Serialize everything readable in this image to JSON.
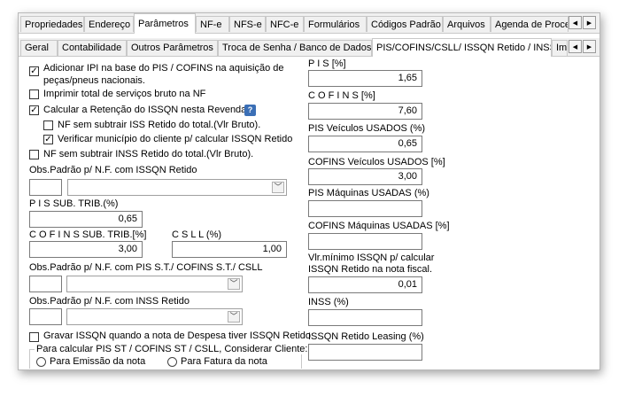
{
  "tabs": [
    "Propriedades",
    "Endereço",
    "Parâmetros",
    "NF-e",
    "NFS-e",
    "NFC-e",
    "Formulários",
    "Códigos Padrão",
    "Arquivos",
    "Agenda de Proces"
  ],
  "subtabs": [
    "Geral",
    "Contabilidade",
    "Outros Parâmetros",
    "Troca de Senha / Banco de Dados",
    "PIS/COFINS/CSLL/ ISSQN Retido / INSS",
    "Im"
  ],
  "left": {
    "cb_ipi": "Adicionar IPI na base do PIS / COFINS na aquisição de",
    "cb_ipi_2": "peças/pneus nacionais.",
    "cb_imprimir": "Imprimir total de serviços bruto na NF",
    "cb_calcular": "Calcular a Retenção do ISSQN nesta Revenda",
    "help_glyph": "?",
    "cb_nf_iss": "NF sem subtrair ISS Retido do total.(Vlr Bruto).",
    "cb_verificar": "Verificar município do cliente p/ calcular ISSQN Retido",
    "cb_nf_inss": "NF sem subtrair INSS Retido do total.(Vlr Bruto).",
    "obs_issqn": "Obs.Padrão p/ N.F. com ISSQN Retido",
    "pis_sub_label": "P I S  SUB. TRIB.(%)",
    "pis_sub_value": "0,65",
    "cofins_sub_label": "C O F I N S  SUB. TRIB.[%]",
    "cofins_sub_value": "3,00",
    "csll_label": "C S L L (%)",
    "csll_value": "1,00",
    "obs_pis_st": "Obs.Padrão p/ N.F. com PIS S.T./ COFINS S.T./ CSLL",
    "obs_inss": "Obs.Padrão p/ N.F. com INSS Retido",
    "cb_gravar": "Gravar ISSQN quando a nota de Despesa tiver ISSQN Retido",
    "group_label": "Para calcular PIS ST / COFINS ST / CSLL, Considerar Cliente:",
    "radio_emissao": "Para Emissão da nota",
    "radio_fatura": "Para Fatura da nota"
  },
  "right": {
    "pis_label": "P I S  [%]",
    "pis_value": "1,65",
    "cofins_label": "C O F I N S  [%]",
    "cofins_value": "7,60",
    "pis_veic_label": "PIS Veículos  USADOS (%)",
    "pis_veic_value": "0,65",
    "cofins_veic_label": "COFINS Veículos  USADOS [%]",
    "cofins_veic_value": "3,00",
    "pis_maq_label": "PIS Máquinas  USADAS (%)",
    "pis_maq_value": "",
    "cofins_maq_label": "COFINS Máquinas USADAS [%]",
    "cofins_maq_value": "",
    "vlr_min_label": "Vlr.mínimo ISSQN p/ calcular",
    "vlr_min_label_2": "ISSQN Retido na nota fiscal.",
    "vlr_min_value": "0,01",
    "inss_label": "INSS (%)",
    "inss_value": "",
    "leasing_label": "ISSQN Retido Leasing (%)",
    "leasing_value": ""
  },
  "checkbox_states": {
    "ipi": true,
    "imprimir": false,
    "calcular": true,
    "nf_iss": false,
    "verificar": true,
    "nf_inss": false,
    "gravar": false
  },
  "glyphs": {
    "check": "✓",
    "scroll_left": "◀",
    "scroll_right": "▶",
    "dropdown": "﹀"
  }
}
